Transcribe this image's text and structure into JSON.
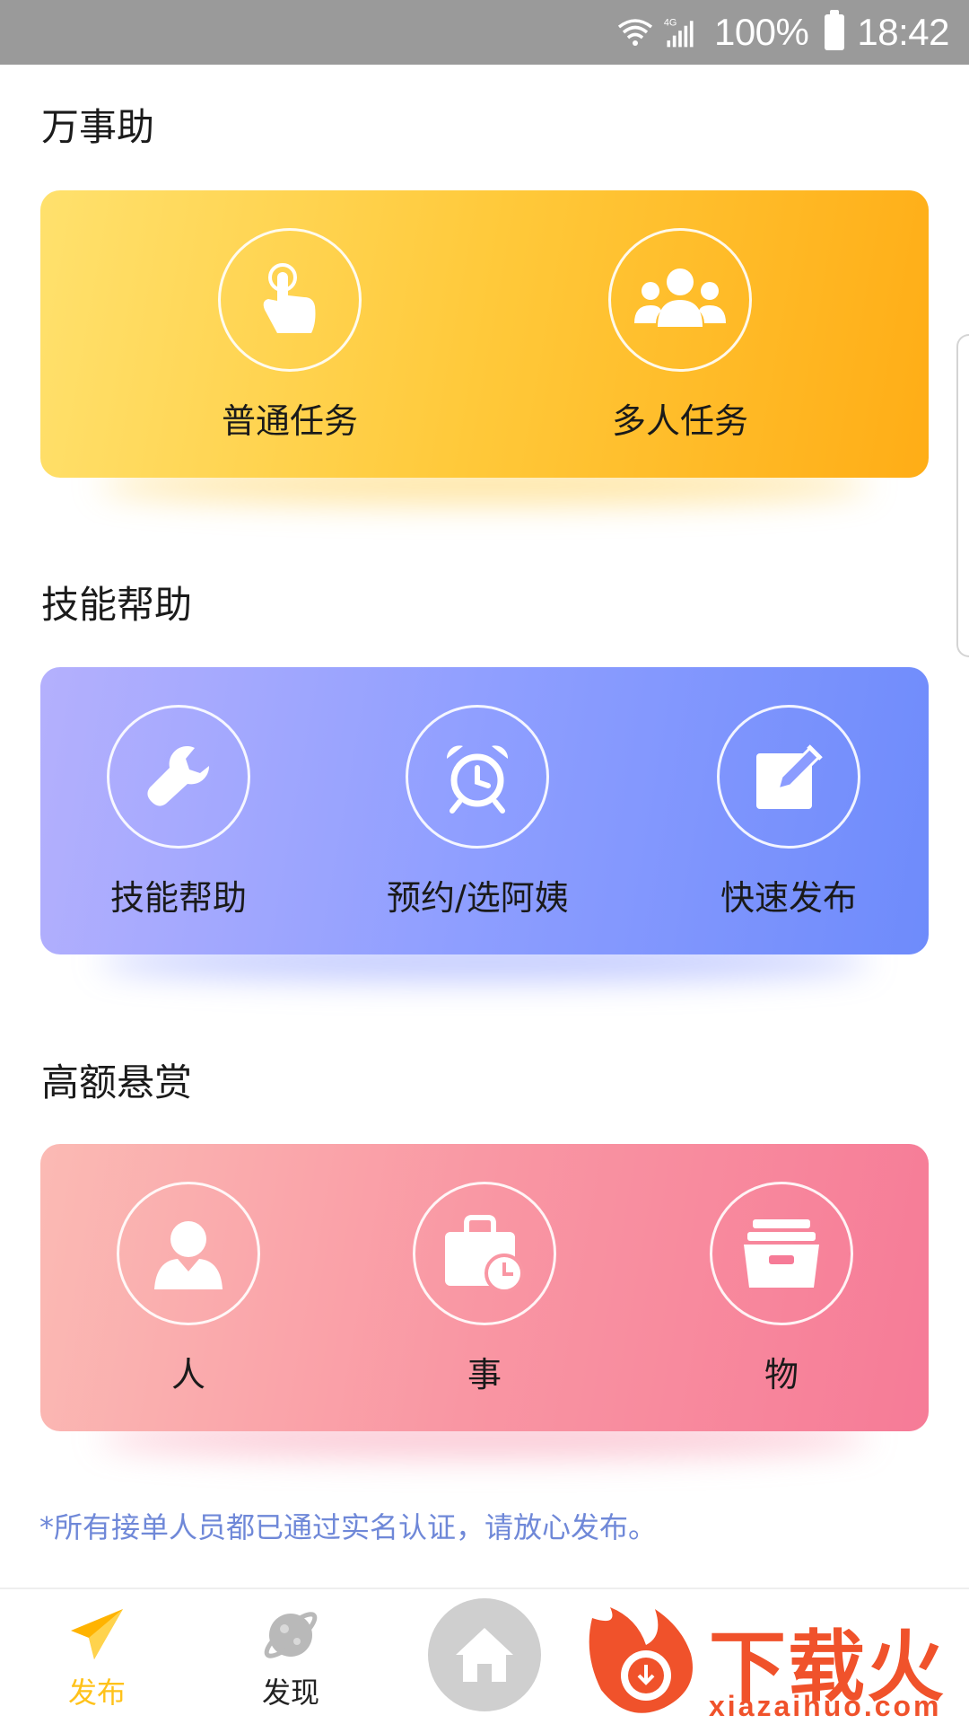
{
  "status_bar": {
    "network": "4G",
    "battery": "100%",
    "time": "18:42"
  },
  "sections": [
    {
      "title": "万事助",
      "items": [
        {
          "label": "普通任务",
          "icon": "tap-finger-icon"
        },
        {
          "label": "多人任务",
          "icon": "group-icon"
        }
      ]
    },
    {
      "title": "技能帮助",
      "items": [
        {
          "label": "技能帮助",
          "icon": "wrench-icon"
        },
        {
          "label": "预约/选阿姨",
          "icon": "alarm-clock-icon"
        },
        {
          "label": "快速发布",
          "icon": "edit-icon"
        }
      ]
    },
    {
      "title": "高额悬赏",
      "items": [
        {
          "label": "人",
          "icon": "person-icon"
        },
        {
          "label": "事",
          "icon": "briefcase-clock-icon"
        },
        {
          "label": "物",
          "icon": "box-icon"
        }
      ]
    }
  ],
  "note": "*所有接单人员都已通过实名认证，请放心发布。",
  "bottom_nav": {
    "items": [
      {
        "label": "发布",
        "icon": "paper-plane-icon",
        "active": true
      },
      {
        "label": "发现",
        "icon": "planet-icon",
        "active": false
      },
      {
        "label": "",
        "icon": "home-icon",
        "active": false
      }
    ]
  },
  "watermark": {
    "text": "下载火",
    "sub": "xiazaihuo.com"
  },
  "colors": {
    "active": "#ffc21a",
    "note": "#6f88d8",
    "watermark": "#f0522b"
  }
}
